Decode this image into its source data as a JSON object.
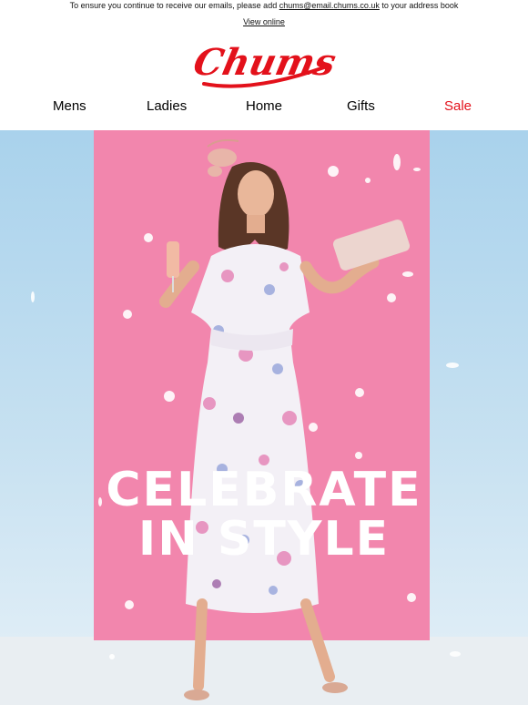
{
  "preheader": {
    "prefix": "To ensure you continue to receive our emails, please add ",
    "email": "chums@email.chums.co.uk",
    "suffix": " to your address book",
    "view_online": "View online"
  },
  "brand": {
    "logo_text": "Chums",
    "logo_color": "#e3111b"
  },
  "nav": {
    "items": [
      {
        "label": "Mens"
      },
      {
        "label": "Ladies"
      },
      {
        "label": "Home"
      },
      {
        "label": "Gifts"
      },
      {
        "label": "Sale",
        "color": "#e3111b"
      }
    ]
  },
  "hero": {
    "headline_line1": "CELEBRATE",
    "headline_line2": "IN STYLE",
    "background_color": "#a9d2ec",
    "panel_color": "#f286ad"
  }
}
